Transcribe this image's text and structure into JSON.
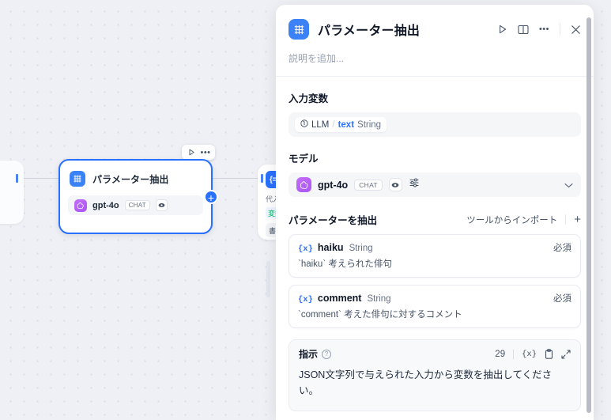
{
  "canvas": {
    "selected_node": {
      "title": "パラメーター抽出",
      "icon": "parameter-extract-icon",
      "model": {
        "name": "gpt-4o",
        "badge": "CHAT",
        "vision_icon": "eye-icon",
        "provider_icon": "openai-icon"
      },
      "toolbar": {
        "run_icon": "play-icon",
        "more_icon": "ellipsis-icon"
      },
      "add_connector": "+"
    },
    "right_node": {
      "badge": "{=}",
      "line1": "代入",
      "chip1": "変数",
      "chip2": "書式"
    }
  },
  "panel": {
    "header": {
      "icon": "parameter-extract-icon",
      "title": "パラメーター抽出",
      "actions": [
        {
          "name": "run-button",
          "icon": "play-icon"
        },
        {
          "name": "panel-toggle-button",
          "icon": "book-icon"
        },
        {
          "name": "more-button",
          "icon": "ellipsis-icon"
        },
        {
          "name": "close-button",
          "icon": "close-icon"
        }
      ],
      "description_placeholder": "説明を追加..."
    },
    "input_variables": {
      "title": "入力変数",
      "variable": {
        "node_label": "LLM",
        "separator": "/",
        "key": "text",
        "type": "String",
        "icon": "info-icon"
      }
    },
    "model_section": {
      "title": "モデル",
      "name": "gpt-4o",
      "badge": "CHAT",
      "vision_icon": "eye-icon",
      "settings_icon": "sliders-icon",
      "chevron_icon": "chevron-down-icon",
      "provider_icon": "openai-icon"
    },
    "parameters": {
      "title": "パラメーターを抽出",
      "import_label": "ツールからインポート",
      "add_label": "+",
      "items": [
        {
          "name": "haiku",
          "type": "String",
          "required_label": "必須",
          "description": "`haiku` 考えられた俳句"
        },
        {
          "name": "comment",
          "type": "String",
          "required_label": "必須",
          "description": "`comment` 考えた俳句に対するコメント"
        }
      ]
    },
    "instruction": {
      "label": "指示",
      "help_icon": "question-icon",
      "char_count": "29",
      "variable_icon": "{x}",
      "copy_icon": "clipboard-icon",
      "expand_icon": "expand-icon",
      "text": "JSON文字列で与えられた入力から変数を抽出してください。"
    }
  },
  "colors": {
    "accent_blue": "#2970ff",
    "node_icon_blue": "#3b82f6",
    "openai_purple": "#a855f7",
    "canvas_bg": "#eef0f5"
  }
}
